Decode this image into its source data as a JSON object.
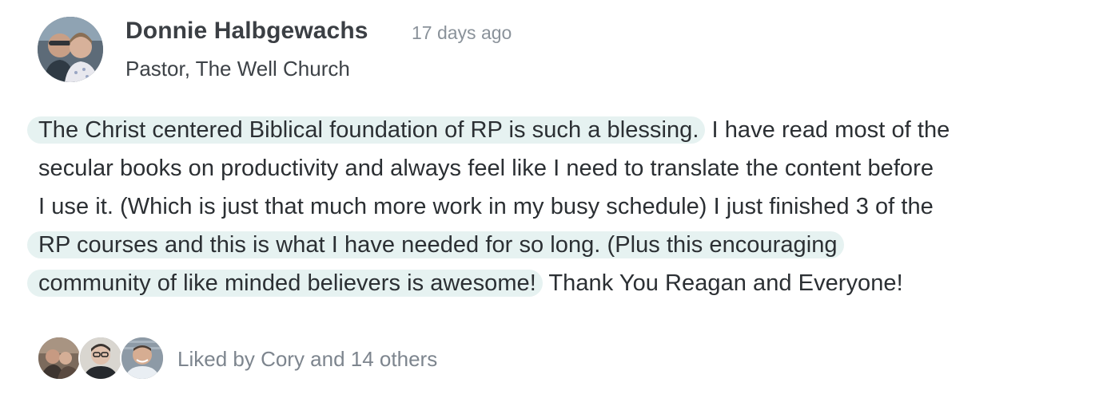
{
  "post": {
    "author": {
      "name": "Donnie Halbgewachs",
      "title": "Pastor, The Well Church",
      "avatar_icon": "author-avatar-photo"
    },
    "timestamp": "17 days ago",
    "body_lines": [
      {
        "highlighted": "The Christ centered Biblical foundation of RP is such a blessing.",
        "plain": " I have read most of the"
      },
      {
        "highlighted": "",
        "plain": "secular books on productivity and always feel like I need to translate the content before"
      },
      {
        "highlighted": "",
        "plain": "I use it. (Which is just that much more work in my busy schedule) I just finished 3 of the"
      },
      {
        "highlighted": "RP courses and this is what I have needed for so long. (Plus this encouraging",
        "plain": ""
      },
      {
        "highlighted": "community of like minded believers is awesome!",
        "plain": " Thank You Reagan and Everyone!"
      }
    ],
    "highlight_color": "#e6f2f1",
    "likes": {
      "text": "Liked by Cory and 14 others",
      "liker_avatars": [
        "liker-avatar-1",
        "liker-avatar-2",
        "liker-avatar-3"
      ]
    }
  }
}
